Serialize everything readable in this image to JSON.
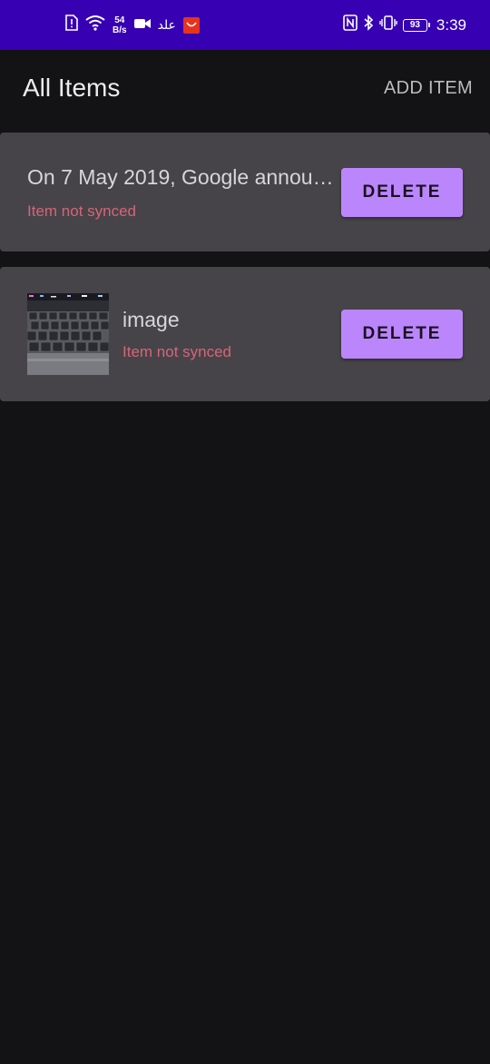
{
  "status_bar": {
    "net_speed_value": "54",
    "net_speed_unit": "B/s",
    "app_icon_text": "AliExpress",
    "arabic_text": "علد",
    "battery_level": "93",
    "time": "3:39",
    "bg_color": "#3700b3"
  },
  "app_bar": {
    "title": "All Items",
    "add_item_label": "ADD ITEM"
  },
  "items": [
    {
      "title": "On 7 May 2019, Google announ...",
      "status": "Item not synced",
      "delete_label": "DELETE",
      "has_image": false
    },
    {
      "title": "image",
      "status": "Item not synced",
      "delete_label": "DELETE",
      "has_image": true
    }
  ],
  "colors": {
    "background": "#131215",
    "card": "#464448",
    "accent_button": "#bb86fc",
    "status_text": "#d8647a"
  }
}
